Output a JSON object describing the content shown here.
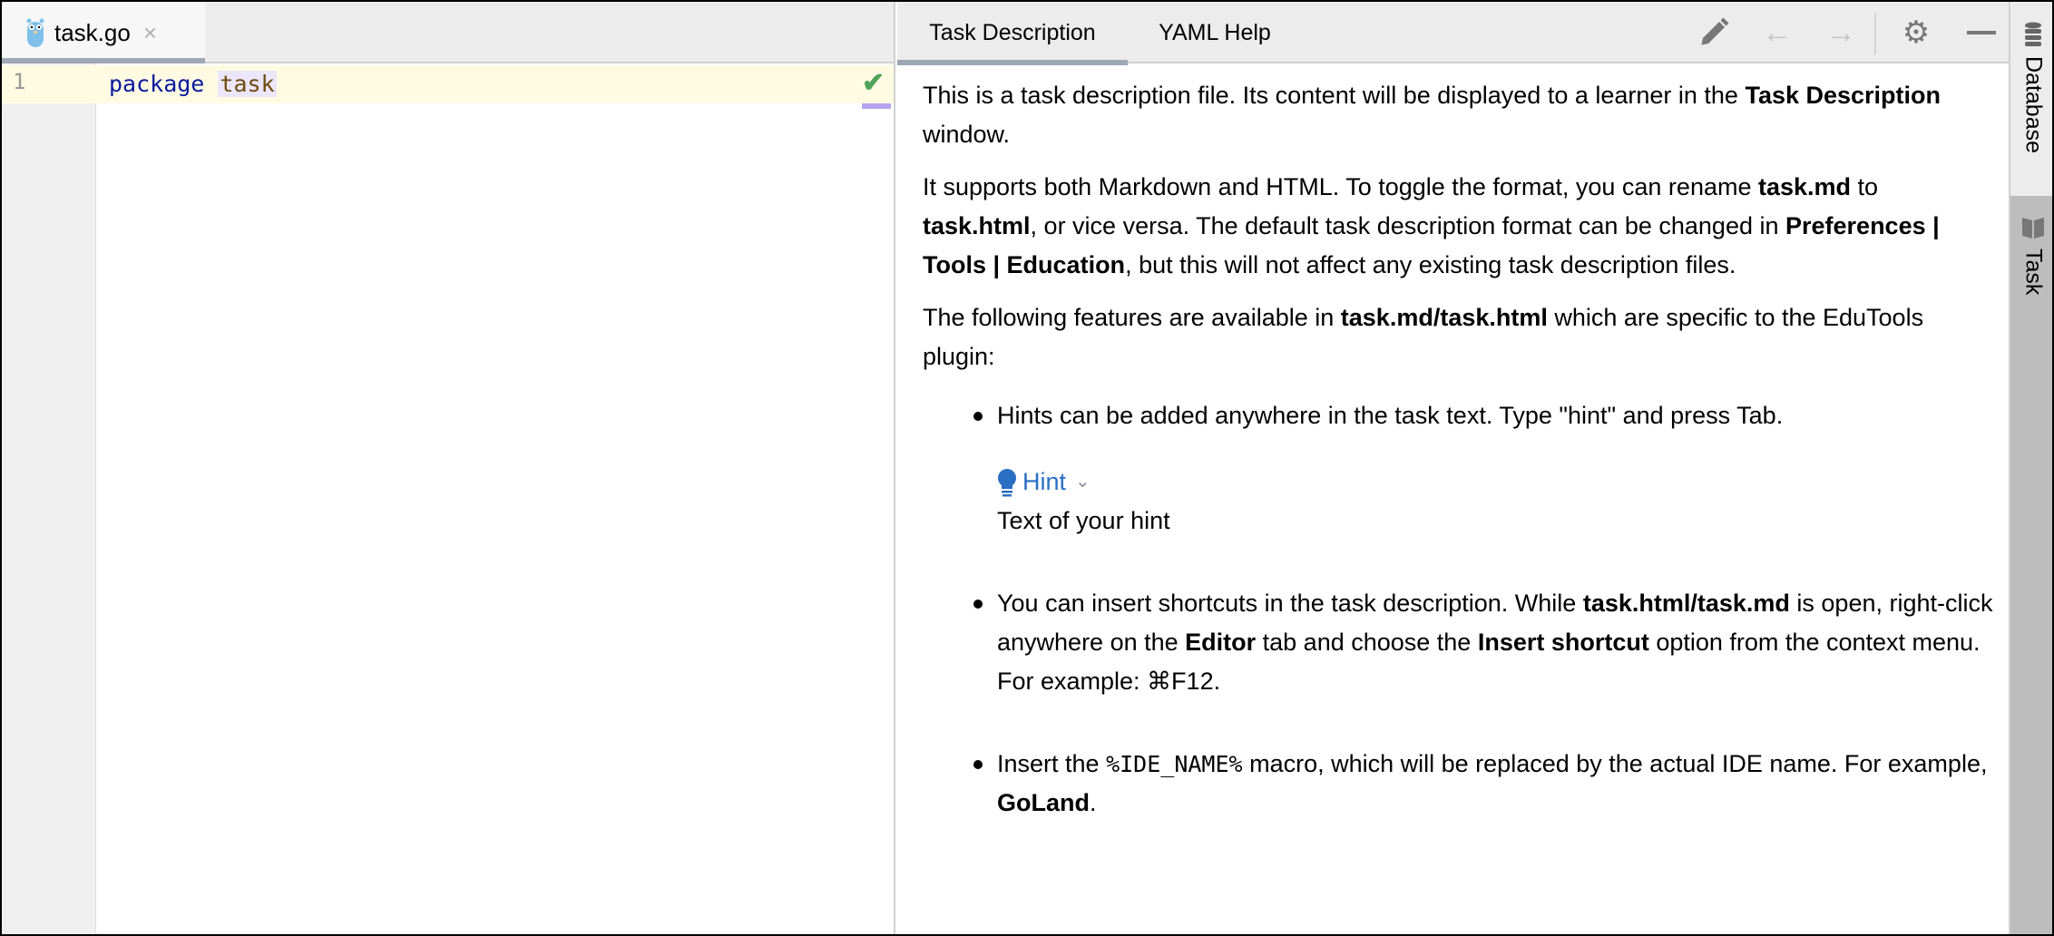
{
  "editor": {
    "tab": {
      "label": "task.go",
      "icon": "gopher-icon",
      "close": "×"
    },
    "line_number": "1",
    "code": {
      "keyword": "package",
      "identifier": "task"
    },
    "status_icon": "check-icon"
  },
  "panel": {
    "tabs": [
      {
        "label": "Task Description",
        "active": true
      },
      {
        "label": "YAML Help",
        "active": false
      }
    ],
    "toolbar": [
      "pencil-icon",
      "back-arrow-icon",
      "forward-arrow-icon",
      "gear-icon",
      "minimize-icon"
    ]
  },
  "description": {
    "p1": [
      "This is a task description file. Its content will be displayed to a learner in the ",
      "Task Description",
      " window."
    ],
    "p2": [
      "It supports both Markdown and HTML. To toggle the format, you can rename ",
      "task.md",
      " to ",
      "task.html",
      ", or vice versa. The default task description format can be changed in ",
      "Preferences | Tools | Education",
      ", but this will not affect any existing task description files."
    ],
    "p3": [
      "The following features are available in ",
      "task.md/task.html",
      " which are specific to the EduTools plugin:"
    ],
    "bullet1": "Hints can be added anywhere in the task text. Type \"hint\" and press Tab.",
    "hint_label": "Hint",
    "hint_text": "Text of your hint",
    "bullet2": [
      "You can insert shortcuts in the task description. While ",
      "task.html/task.md",
      " is open, right-click anywhere on the ",
      "Editor",
      " tab and choose the ",
      "Insert shortcut",
      " option from the context menu. For example: ⌘F12."
    ],
    "bullet3": [
      "Insert the ",
      "%IDE_NAME%",
      " macro, which will be replaced by the actual IDE name. For example, ",
      "GoLand",
      "."
    ]
  },
  "sidebar": {
    "items": [
      {
        "label": "Database",
        "icon": "database-icon"
      },
      {
        "label": "Task",
        "icon": "book-icon",
        "active": true
      }
    ]
  },
  "colors": {
    "accent_link": "#2a6fc4",
    "check": "#4ea35a",
    "line_highlight": "#fefbe2"
  }
}
